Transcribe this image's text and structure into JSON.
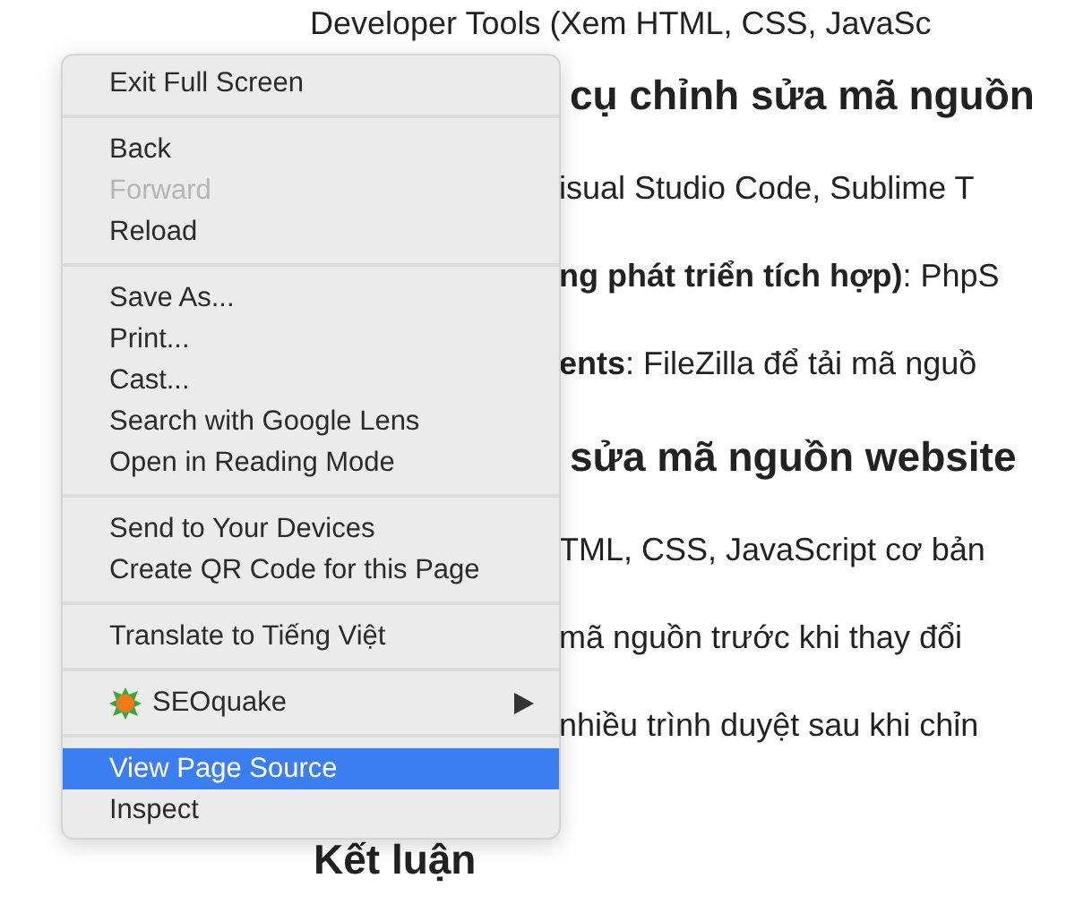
{
  "page": {
    "lines": [
      {
        "kind": "lead",
        "text": "Developer Tools (Xem HTML, CSS, JavaSc"
      },
      {
        "kind": "heading",
        "text": "cụ chỉnh sửa mã nguồn"
      },
      {
        "kind": "text",
        "text": "isual Studio Code, Sublime T"
      },
      {
        "kind": "text",
        "text": "**ng phát triển tích hợp)**: PhpS"
      },
      {
        "kind": "text",
        "text": "**ents**: FileZilla để tải mã nguồ"
      },
      {
        "kind": "heading",
        "text": "sửa mã nguồn website"
      },
      {
        "kind": "text",
        "text": "TML, CSS, JavaScript cơ bản"
      },
      {
        "kind": "text",
        "text": "mã nguồn trước khi thay đổi"
      },
      {
        "kind": "text",
        "text": "nhiều trình duyệt sau khi chỉn"
      },
      {
        "kind": "closing",
        "text": "Kết luận"
      }
    ]
  },
  "context_menu": {
    "groups": [
      [
        {
          "kind": "plain",
          "label": "Exit Full Screen",
          "disabled": false,
          "selected": false,
          "submenu": false
        }
      ],
      [
        {
          "kind": "plain",
          "label": "Back",
          "disabled": false,
          "selected": false,
          "submenu": false
        },
        {
          "kind": "plain",
          "label": "Forward",
          "disabled": true,
          "selected": false,
          "submenu": false
        },
        {
          "kind": "plain",
          "label": "Reload",
          "disabled": false,
          "selected": false,
          "submenu": false
        }
      ],
      [
        {
          "kind": "plain",
          "label": "Save As...",
          "disabled": false,
          "selected": false,
          "submenu": false
        },
        {
          "kind": "plain",
          "label": "Print...",
          "disabled": false,
          "selected": false,
          "submenu": false
        },
        {
          "kind": "plain",
          "label": "Cast...",
          "disabled": false,
          "selected": false,
          "submenu": false
        },
        {
          "kind": "plain",
          "label": "Search with Google Lens",
          "disabled": false,
          "selected": false,
          "submenu": false
        },
        {
          "kind": "plain",
          "label": "Open in Reading Mode",
          "disabled": false,
          "selected": false,
          "submenu": false
        }
      ],
      [
        {
          "kind": "plain",
          "label": "Send to Your Devices",
          "disabled": false,
          "selected": false,
          "submenu": false
        },
        {
          "kind": "plain",
          "label": "Create QR Code for this Page",
          "disabled": false,
          "selected": false,
          "submenu": false
        }
      ],
      [
        {
          "kind": "plain",
          "label": "Translate to Tiếng Việt",
          "disabled": false,
          "selected": false,
          "submenu": false
        }
      ],
      [
        {
          "kind": "extension",
          "label": "SEOquake",
          "disabled": false,
          "selected": false,
          "submenu": true
        }
      ],
      [
        {
          "kind": "plain",
          "label": "View Page Source",
          "disabled": false,
          "selected": true,
          "submenu": false
        },
        {
          "kind": "plain",
          "label": "Inspect",
          "disabled": false,
          "selected": false,
          "submenu": false
        }
      ]
    ]
  }
}
